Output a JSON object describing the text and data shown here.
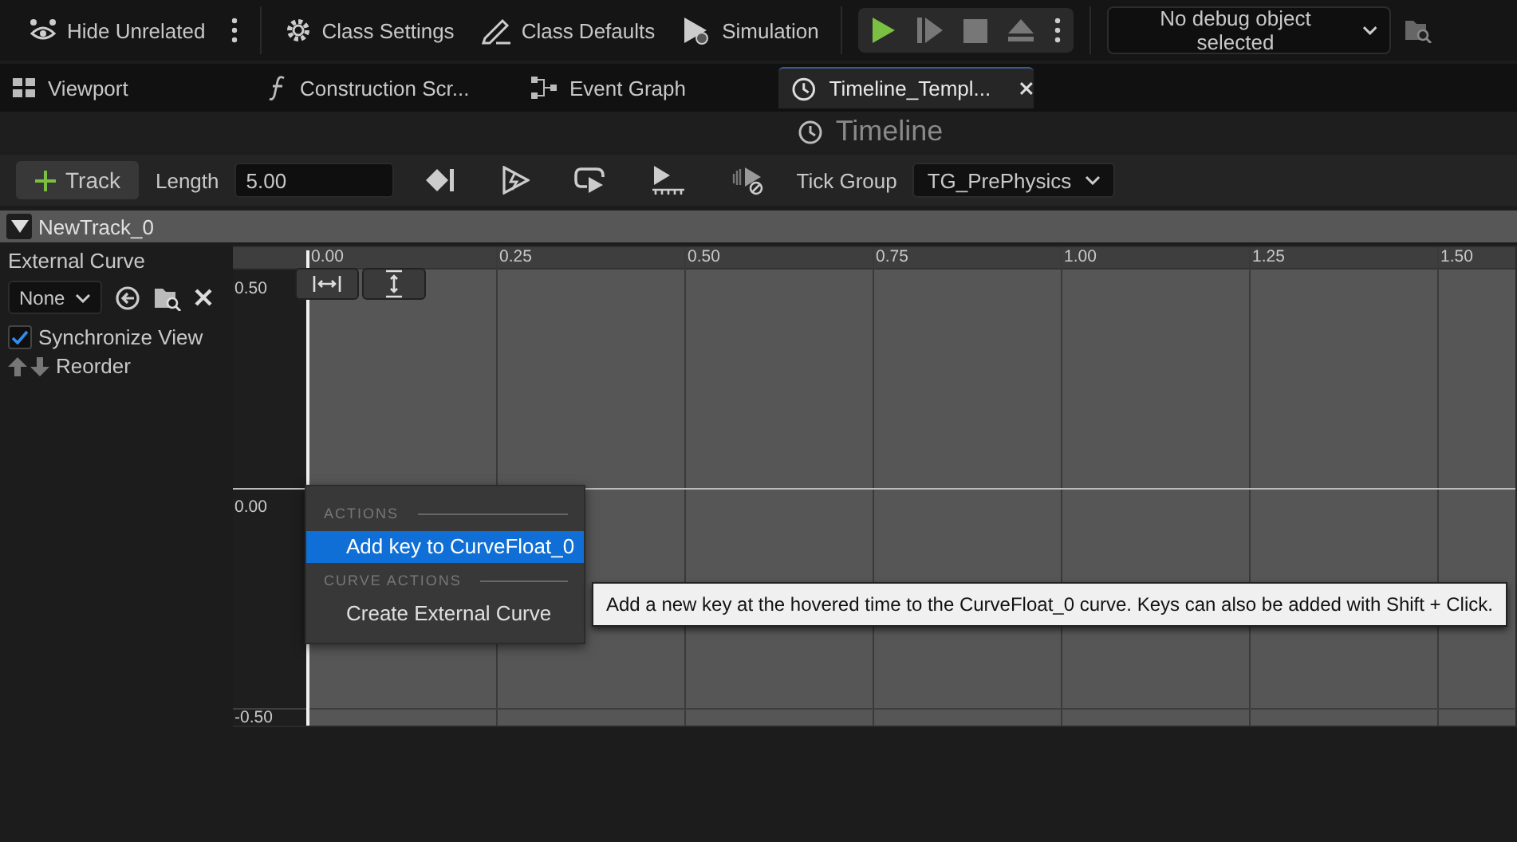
{
  "toolbar": {
    "buttons": [
      {
        "label": "Hide Unrelated"
      },
      {
        "label": "Class Settings"
      },
      {
        "label": "Class Defaults"
      },
      {
        "label": "Simulation"
      }
    ],
    "debug_object": "No debug object selected"
  },
  "tabs": [
    {
      "label": "Viewport",
      "selected": false
    },
    {
      "label": "Construction Scr...",
      "selected": false
    },
    {
      "label": "Event Graph",
      "selected": false
    },
    {
      "label": "Timeline_Templ...",
      "selected": true
    }
  ],
  "panel_title": "Timeline",
  "timeline_toolbar": {
    "add_track": "Track",
    "length_label": "Length",
    "length": "5.00",
    "tick_group_label": "Tick Group",
    "tick_group": "TG_PrePhysics"
  },
  "track": {
    "name": "NewTrack_0",
    "expanded": true,
    "external_curve_label": "External Curve",
    "external_curve": "None",
    "synchronize_view": {
      "label": "Synchronize View",
      "checked": true
    },
    "reorder": "Reorder"
  },
  "graph": {
    "time_ticks": [
      "0.00",
      "0.25",
      "0.50",
      "0.75",
      "1.00",
      "1.25",
      "1.50"
    ],
    "value_ticks": [
      "0.50",
      "0.00",
      "-0.50"
    ]
  },
  "context_menu": {
    "sections": [
      {
        "heading": "ACTIONS",
        "items": [
          {
            "label": "Add key to CurveFloat_0",
            "selected": true
          }
        ]
      },
      {
        "heading": "CURVE ACTIONS",
        "items": [
          {
            "label": "Create External Curve",
            "selected": false
          }
        ]
      }
    ]
  },
  "tooltip": "Add a new key at the hovered time to the CurveFloat_0 curve.  Keys can also be added with Shift + Click."
}
